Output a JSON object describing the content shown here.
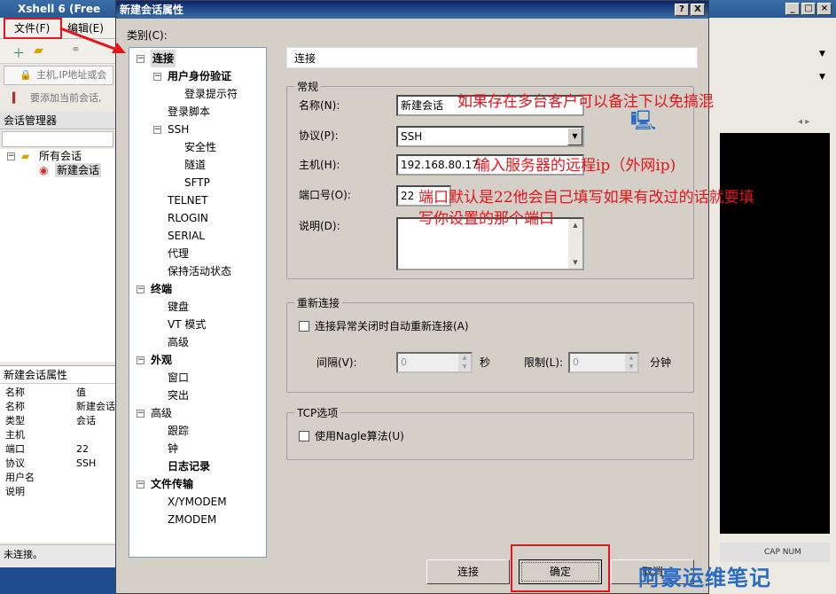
{
  "bg": {
    "title": "Xshell 6 (Free",
    "menu_file": "文件(F)",
    "menu_edit": "编辑(E)",
    "addr_placeholder": "主机,IP地址或会",
    "hint": "要添加当前会话,",
    "session_manager": "会话管理器",
    "tree_all": "所有会话",
    "tree_new": "新建会话",
    "props_title": "新建会话属性",
    "props_header": [
      "名称",
      "值"
    ],
    "props": [
      [
        "名称",
        "新建会话"
      ],
      [
        "类型",
        "会话"
      ],
      [
        "主机",
        ""
      ],
      [
        "端口",
        "22"
      ],
      [
        "协议",
        "SSH"
      ],
      [
        "用户名",
        ""
      ],
      [
        "说明",
        ""
      ]
    ],
    "status": "未连接。",
    "right_status": "CAP  NUM"
  },
  "dialog": {
    "title": "新建会话属性",
    "help_btn": "?",
    "close_btn": "X",
    "category_label": "类别(C):",
    "tree": [
      {
        "label": "连接",
        "level": 0,
        "bold": true,
        "exp": "−"
      },
      {
        "label": "用户身份验证",
        "level": 1,
        "bold": true,
        "exp": "−"
      },
      {
        "label": "登录提示符",
        "level": 2,
        "bold": false
      },
      {
        "label": "登录脚本",
        "level": 1,
        "bold": false
      },
      {
        "label": "SSH",
        "level": 1,
        "bold": false,
        "exp": "−"
      },
      {
        "label": "安全性",
        "level": 2,
        "bold": false
      },
      {
        "label": "隧道",
        "level": 2,
        "bold": false
      },
      {
        "label": "SFTP",
        "level": 2,
        "bold": false
      },
      {
        "label": "TELNET",
        "level": 1,
        "bold": false
      },
      {
        "label": "RLOGIN",
        "level": 1,
        "bold": false
      },
      {
        "label": "SERIAL",
        "level": 1,
        "bold": false
      },
      {
        "label": "代理",
        "level": 1,
        "bold": false
      },
      {
        "label": "保持活动状态",
        "level": 1,
        "bold": false
      },
      {
        "label": "终端",
        "level": 0,
        "bold": true,
        "exp": "−"
      },
      {
        "label": "键盘",
        "level": 1,
        "bold": false
      },
      {
        "label": "VT 模式",
        "level": 1,
        "bold": false
      },
      {
        "label": "高级",
        "level": 1,
        "bold": false
      },
      {
        "label": "外观",
        "level": 0,
        "bold": true,
        "exp": "−"
      },
      {
        "label": "窗口",
        "level": 1,
        "bold": false
      },
      {
        "label": "突出",
        "level": 1,
        "bold": false
      },
      {
        "label": "高级",
        "level": 0,
        "bold": false,
        "exp": "−"
      },
      {
        "label": "跟踪",
        "level": 1,
        "bold": false
      },
      {
        "label": "钟",
        "level": 1,
        "bold": false
      },
      {
        "label": "日志记录",
        "level": 1,
        "bold": true
      },
      {
        "label": "文件传输",
        "level": 0,
        "bold": true,
        "exp": "−"
      },
      {
        "label": "X/YMODEM",
        "level": 1,
        "bold": false
      },
      {
        "label": "ZMODEM",
        "level": 1,
        "bold": false
      }
    ],
    "section": "连接",
    "general": {
      "group": "常规",
      "name_label": "名称(N):",
      "name_value": "新建会话",
      "protocol_label": "协议(P):",
      "protocol_value": "SSH",
      "host_label": "主机(H):",
      "host_value": "192.168.80.17",
      "port_label": "端口号(O):",
      "port_value": "22",
      "desc_label": "说明(D):"
    },
    "reconnect": {
      "group": "重新连接",
      "auto_label": "连接异常关闭时自动重新连接(A)",
      "interval_label": "间隔(V):",
      "interval_value": "0",
      "interval_unit": "秒",
      "limit_label": "限制(L):",
      "limit_value": "0",
      "limit_unit": "分钟"
    },
    "tcp": {
      "group": "TCP选项",
      "nagle_label": "使用Nagle算法(U)"
    },
    "buttons": {
      "connect": "连接",
      "ok": "确定",
      "cancel": "取消"
    }
  },
  "annotations": {
    "name_note": "如果存在多台客户可以备注下以免搞混",
    "host_note": "输入服务器的远程ip（外网ip)",
    "port_note_1": "端口默认是22他会自己填写如果有改过的话就要填",
    "port_note_2": "写你设置的那个端口",
    "highlight_color": "#e8141b"
  },
  "watermark": "阿豪运维笔记"
}
